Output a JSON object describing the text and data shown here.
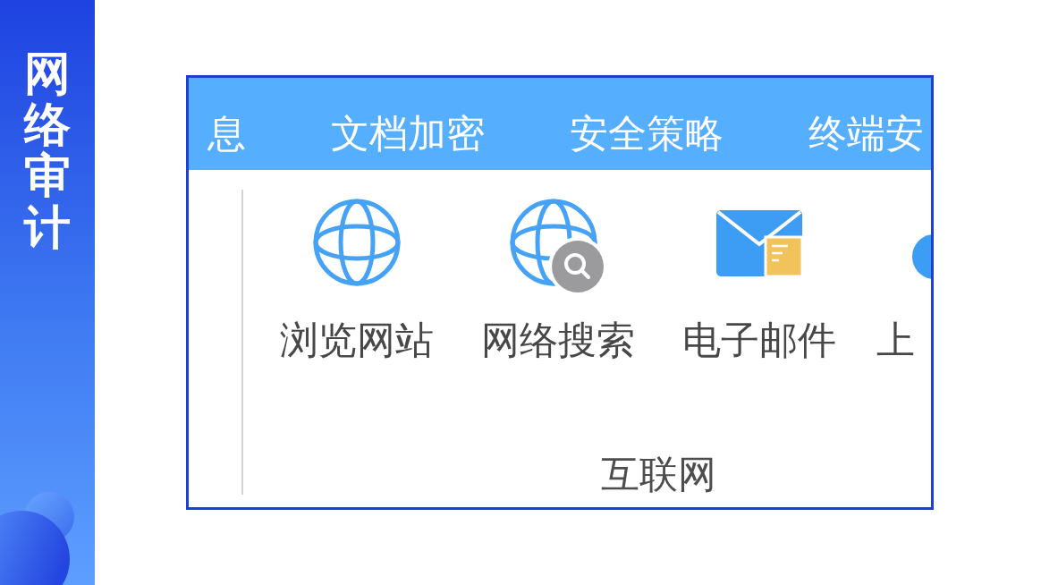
{
  "sidebar": {
    "title": "网络审计"
  },
  "screenshot": {
    "tabs": [
      {
        "label": "息",
        "selected": false
      },
      {
        "label": "文档加密",
        "selected": false
      },
      {
        "label": "安全策略",
        "selected": false
      },
      {
        "label": "终端安",
        "selected": false
      }
    ],
    "group": {
      "label": "互联网",
      "items": [
        {
          "label": "浏览网站",
          "kind": "globe"
        },
        {
          "label": "网络搜索",
          "kind": "search"
        },
        {
          "label": "电子邮件",
          "kind": "mail"
        },
        {
          "label": "上",
          "kind": "disc"
        }
      ]
    }
  }
}
